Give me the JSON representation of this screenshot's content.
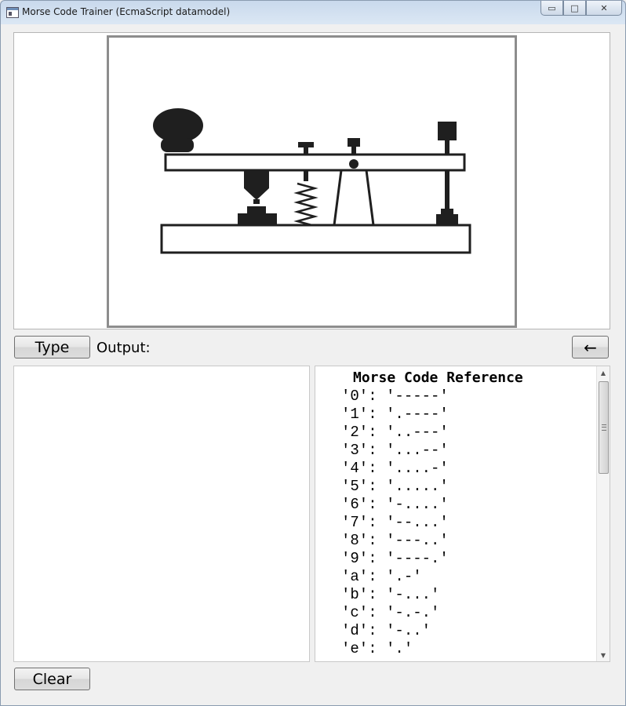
{
  "window": {
    "title": "Morse Code Trainer (EcmaScript datamodel)",
    "minimize_glyph": "▭",
    "maximize_glyph": "□",
    "close_glyph": "✕"
  },
  "controls": {
    "type_label": "Type",
    "output_label": "Output:",
    "backspace_label": "←",
    "clear_label": "Clear"
  },
  "output": {
    "text": ""
  },
  "reference": {
    "title": "Morse Code Reference",
    "entries": [
      "'0': '-----'",
      "'1': '.----'",
      "'2': '..---'",
      "'3': '...--'",
      "'4': '....-'",
      "'5': '.....'",
      "'6': '-....'",
      "'7': '--...'",
      "'8': '---..'",
      "'9': '----.'",
      "'a': '.-'",
      "'b': '-...'",
      "'c': '-.-.'",
      "'d': '-..'",
      "'e': '.'"
    ]
  },
  "icons": {
    "telegraph_key": "telegraph-key-illustration",
    "backspace": "arrow-left-icon"
  },
  "colors": {
    "frame_border": "#8d8d8d",
    "illustration": "#1f1f1f",
    "window_bg": "#f0f0f0"
  }
}
